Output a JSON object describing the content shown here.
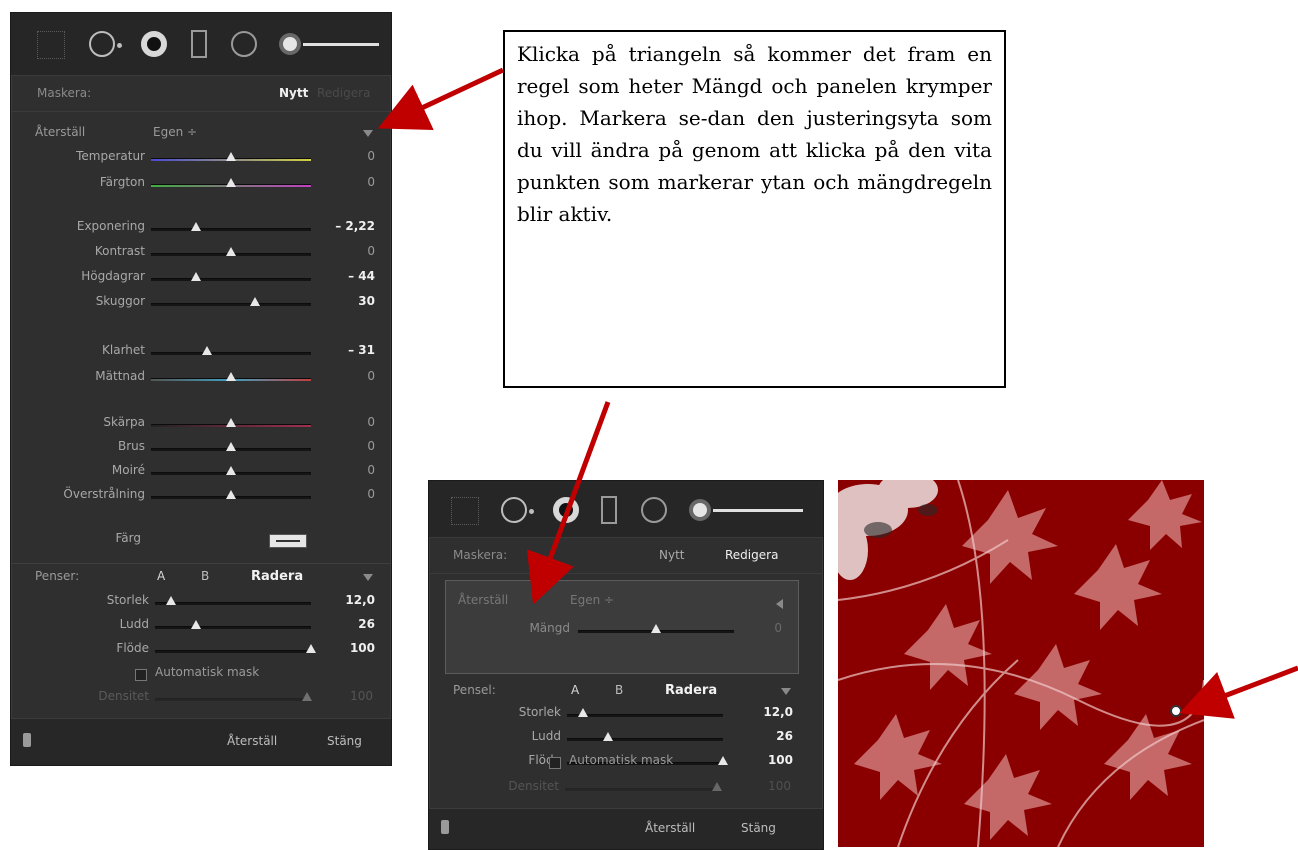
{
  "callout": {
    "text": "Klicka på triangeln så kommer det fram en regel som heter Mängd och panelen krymper ihop. Markera se-dan den justeringsyta som du vill ändra på genom att klicka på den vita punkten som markerar ytan och mängdregeln blir aktiv."
  },
  "panel1": {
    "mask_label": "Maskera:",
    "new_label": "Nytt",
    "edit_label": "Redigera",
    "reset_label": "Återställ",
    "preset_label": "Egen ÷",
    "sliders_a": [
      {
        "label": "Temperatur",
        "value": "0",
        "pos": 0.5
      },
      {
        "label": "Färgton",
        "value": "0",
        "pos": 0.5
      }
    ],
    "sliders_b": [
      {
        "label": "Exponering",
        "value": "– 2,22",
        "pos": 0.28
      },
      {
        "label": "Kontrast",
        "value": "0",
        "pos": 0.5
      },
      {
        "label": "Högdagrar",
        "value": "– 44",
        "pos": 0.28
      },
      {
        "label": "Skuggor",
        "value": "30",
        "pos": 0.65
      }
    ],
    "sliders_c": [
      {
        "label": "Klarhet",
        "value": "– 31",
        "pos": 0.35
      },
      {
        "label": "Mättnad",
        "value": "0",
        "pos": 0.5
      }
    ],
    "sliders_d": [
      {
        "label": "Skärpa",
        "value": "0",
        "pos": 0.5
      },
      {
        "label": "Brus",
        "value": "0",
        "pos": 0.5
      },
      {
        "label": "Moiré",
        "value": "0",
        "pos": 0.5
      },
      {
        "label": "Överstrålning",
        "value": "0",
        "pos": 0.5
      }
    ],
    "color_label": "Färg",
    "brush_label": "Penser:",
    "brush_a": "A",
    "brush_b": "B",
    "brush_erase": "Radera",
    "brush_sliders": [
      {
        "label": "Storlek",
        "value": "12,0",
        "pos": 0.1
      },
      {
        "label": "Ludd",
        "value": "26",
        "pos": 0.26
      },
      {
        "label": "Flöde",
        "value": "100",
        "pos": 1.0
      }
    ],
    "auto_mask": "Automatisk mask",
    "density_label": "Densitet",
    "density_value": "100",
    "footer_reset": "Återställ",
    "footer_close": "Stäng"
  },
  "panel2": {
    "mask_label": "Maskera:",
    "new_label": "Nytt",
    "edit_label": "Redigera",
    "reset_label": "Återställ",
    "preset_label": "Egen ÷",
    "amount_label": "Mängd",
    "amount_value": "0",
    "amount_pos": 0.5,
    "brush_label": "Pensel:",
    "brush_a": "A",
    "brush_b": "B",
    "brush_erase": "Radera",
    "brush_sliders": [
      {
        "label": "Storlek",
        "value": "12,0",
        "pos": 0.1
      },
      {
        "label": "Ludd",
        "value": "26",
        "pos": 0.26
      },
      {
        "label": "Flöde",
        "value": "100",
        "pos": 1.0
      }
    ],
    "auto_mask": "Automatisk mask",
    "density_label": "Densitet",
    "density_value": "100",
    "footer_reset": "Återställ",
    "footer_close": "Stäng"
  },
  "colors": {
    "panel_bg": "#2f2f2f",
    "arrow_red": "#c00000",
    "photo_red": "#8a0000"
  }
}
